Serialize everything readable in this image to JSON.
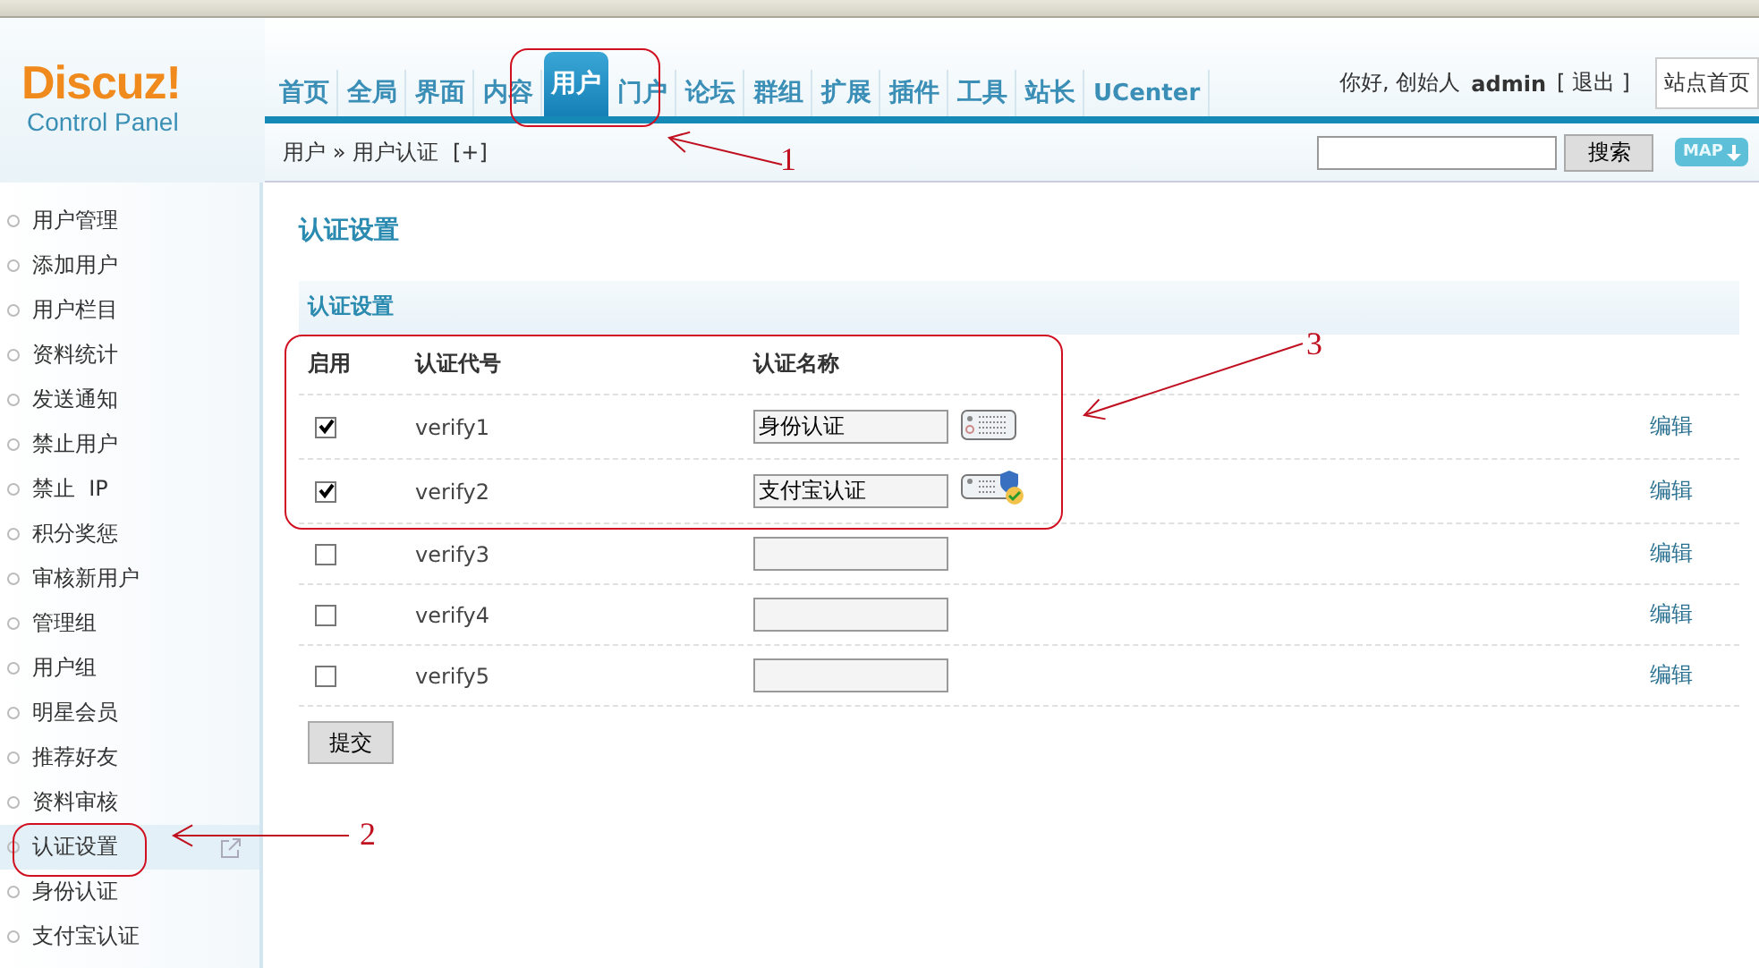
{
  "logo": {
    "name": "Discuz!",
    "subtitle": "Control Panel"
  },
  "nav": [
    {
      "label": "首页",
      "selected": false
    },
    {
      "label": "全局",
      "selected": false
    },
    {
      "label": "界面",
      "selected": false
    },
    {
      "label": "内容",
      "selected": false
    },
    {
      "label": "用户",
      "selected": true
    },
    {
      "label": "门户",
      "selected": false
    },
    {
      "label": "论坛",
      "selected": false
    },
    {
      "label": "群组",
      "selected": false
    },
    {
      "label": "扩展",
      "selected": false
    },
    {
      "label": "插件",
      "selected": false
    },
    {
      "label": "工具",
      "selected": false
    },
    {
      "label": "站长",
      "selected": false
    },
    {
      "label": "UCenter",
      "selected": false
    }
  ],
  "user_bar": {
    "greeting": "你好, 创始人",
    "username": "admin",
    "logout": "[ 退出 ]",
    "site_home": "站点首页"
  },
  "breadcrumb": {
    "path": "用户 » 用户认证",
    "add": "[+]"
  },
  "search": {
    "button": "搜索",
    "map": "MAP"
  },
  "sidebar": {
    "items": [
      {
        "label": "用户管理",
        "selected": false
      },
      {
        "label": "添加用户",
        "selected": false
      },
      {
        "label": "用户栏目",
        "selected": false
      },
      {
        "label": "资料统计",
        "selected": false
      },
      {
        "label": "发送通知",
        "selected": false
      },
      {
        "label": "禁止用户",
        "selected": false
      },
      {
        "label": "禁止  IP",
        "selected": false
      },
      {
        "label": "积分奖惩",
        "selected": false
      },
      {
        "label": "审核新用户",
        "selected": false
      },
      {
        "label": "管理组",
        "selected": false
      },
      {
        "label": "用户组",
        "selected": false
      },
      {
        "label": "明星会员",
        "selected": false
      },
      {
        "label": "推荐好友",
        "selected": false
      },
      {
        "label": "资料审核",
        "selected": false
      },
      {
        "label": "认证设置",
        "selected": true
      },
      {
        "label": "身份认证",
        "selected": false
      },
      {
        "label": "支付宝认证",
        "selected": false
      }
    ]
  },
  "page_title": "认证设置",
  "section_title": "认证设置",
  "table": {
    "columns": [
      "启用",
      "认证代号",
      "认证名称"
    ],
    "rows": [
      {
        "enabled": true,
        "code": "verify1",
        "name": "身份认证",
        "kind": "card",
        "edit": "编辑"
      },
      {
        "enabled": true,
        "code": "verify2",
        "name": "支付宝认证",
        "kind": "card_shield",
        "edit": "编辑"
      },
      {
        "enabled": false,
        "code": "verify3",
        "kind": "none",
        "edit": "编辑"
      },
      {
        "enabled": false,
        "code": "verify4",
        "kind": "none",
        "edit": "编辑"
      },
      {
        "enabled": false,
        "code": "verify5",
        "kind": "none",
        "edit": "编辑"
      }
    ]
  },
  "submit": "提交",
  "annotations": [
    {
      "label": "1"
    },
    {
      "label": "2"
    },
    {
      "label": "3"
    }
  ]
}
